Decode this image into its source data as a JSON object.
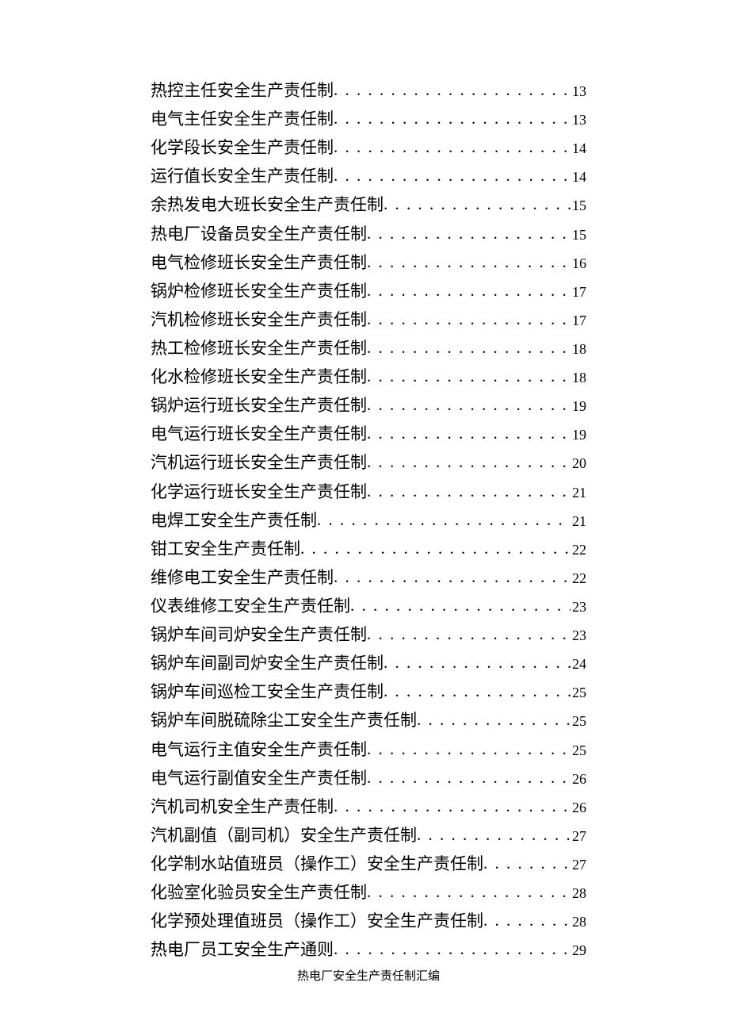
{
  "toc": [
    {
      "title": "热控主任安全生产责任制",
      "page": "13"
    },
    {
      "title": "电气主任安全生产责任制",
      "page": "13"
    },
    {
      "title": "化学段长安全生产责任制",
      "page": "14"
    },
    {
      "title": "运行值长安全生产责任制",
      "page": "14"
    },
    {
      "title": "余热发电大班长安全生产责任制",
      "page": "15"
    },
    {
      "title": "热电厂设备员安全生产责任制",
      "page": "15"
    },
    {
      "title": "电气检修班长安全生产责任制",
      "page": "16"
    },
    {
      "title": "锅炉检修班长安全生产责任制",
      "page": "17"
    },
    {
      "title": "汽机检修班长安全生产责任制",
      "page": "17"
    },
    {
      "title": "热工检修班长安全生产责任制",
      "page": "18"
    },
    {
      "title": "化水检修班长安全生产责任制",
      "page": "18"
    },
    {
      "title": "锅炉运行班长安全生产责任制",
      "page": "19"
    },
    {
      "title": "电气运行班长安全生产责任制",
      "page": "19"
    },
    {
      "title": "汽机运行班长安全生产责任制",
      "page": "20"
    },
    {
      "title": "化学运行班长安全生产责任制",
      "page": "21"
    },
    {
      "title": "电焊工安全生产责任制",
      "page": "21"
    },
    {
      "title": "钳工安全生产责任制",
      "page": "22"
    },
    {
      "title": "维修电工安全生产责任制",
      "page": "22"
    },
    {
      "title": "仪表维修工安全生产责任制",
      "page": "23"
    },
    {
      "title": "锅炉车间司炉安全生产责任制",
      "page": "23"
    },
    {
      "title": "锅炉车间副司炉安全生产责任制",
      "page": "24"
    },
    {
      "title": "锅炉车间巡检工安全生产责任制",
      "page": "25"
    },
    {
      "title": "锅炉车间脱硫除尘工安全生产责任制",
      "page": "25"
    },
    {
      "title": "电气运行主值安全生产责任制",
      "page": "25"
    },
    {
      "title": "电气运行副值安全生产责任制",
      "page": "26"
    },
    {
      "title": "汽机司机安全生产责任制",
      "page": "26"
    },
    {
      "title": "汽机副值（副司机）安全生产责任制",
      "page": "27"
    },
    {
      "title": "化学制水站值班员（操作工）安全生产责任制",
      "page": "27"
    },
    {
      "title": "化验室化验员安全生产责任制",
      "page": "28"
    },
    {
      "title": "化学预处理值班员（操作工）安全生产责任制",
      "page": "28"
    },
    {
      "title": "热电厂员工安全生产通则",
      "page": "29"
    }
  ],
  "footer": "热电厂安全生产责任制汇编"
}
